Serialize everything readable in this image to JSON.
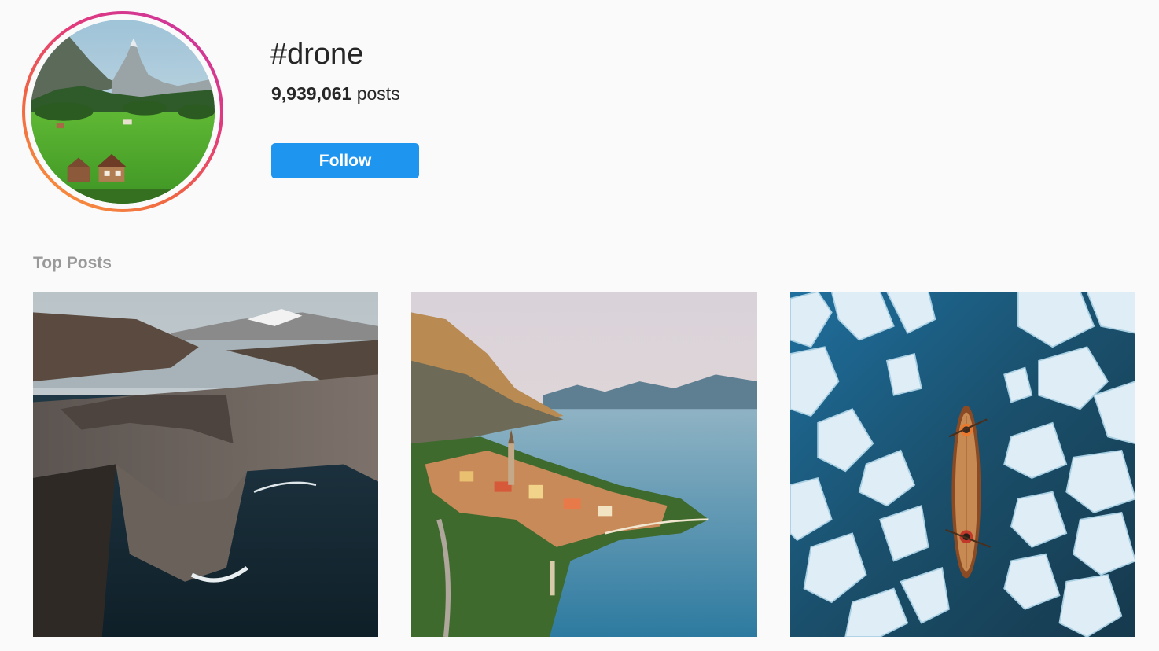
{
  "header": {
    "hashtag": "#drone",
    "post_count": "9,939,061",
    "post_count_suffix": "posts",
    "follow_label": "Follow",
    "avatar_image": "alpine-meadow-with-chalets",
    "avatar_ring_colors": [
      "#f9a13b",
      "#f06443",
      "#e23a7c",
      "#c535a8"
    ]
  },
  "top_posts": {
    "title": "Top Posts",
    "items": [
      {
        "image": "sea-cliff-above-ocean-with-lake"
      },
      {
        "image": "lakeside-village-aerial"
      },
      {
        "image": "canoe-among-ice-floes-aerial"
      }
    ]
  },
  "colors": {
    "background": "#fafafa",
    "follow_button": "#1e95ee",
    "primary_text": "#262626",
    "muted_text": "#999999"
  }
}
